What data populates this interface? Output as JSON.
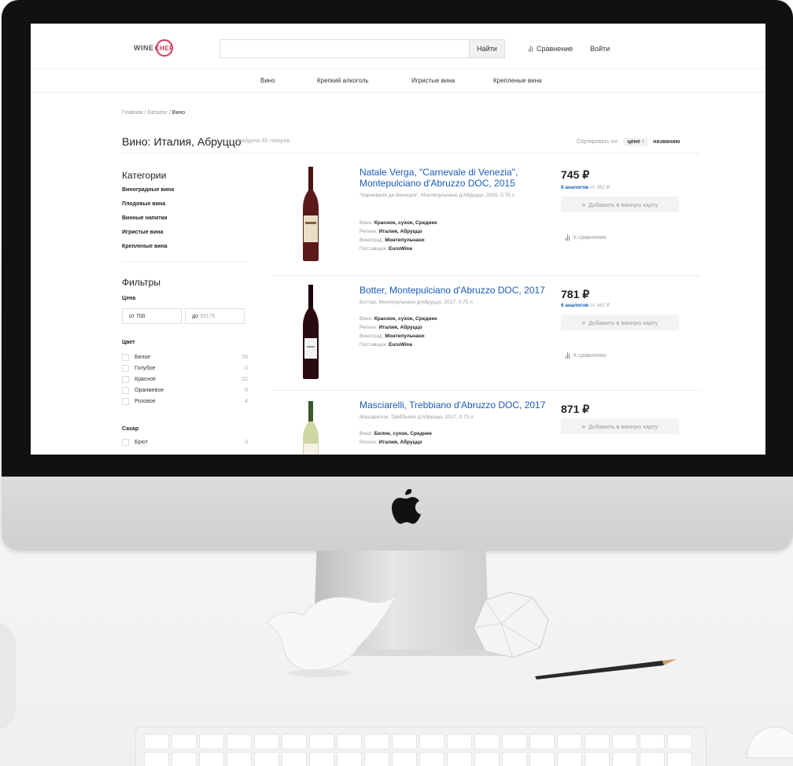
{
  "header": {
    "logo_left": "WINE",
    "logo_right": "CHEF",
    "search_value": "",
    "search_button": "Найти",
    "compare_link": "Сравнение",
    "login_link": "Войти"
  },
  "nav": [
    "Вино",
    "Крепкий алкоголь",
    "Игристые вина",
    "Крепленые вина"
  ],
  "breadcrumb": {
    "home": "Главная",
    "sep": " / ",
    "catalog": "Каталог",
    "current": "Вино"
  },
  "page": {
    "title": "Вино: Италия, Абруццо",
    "found": "Найдено 55 товаров",
    "sort_label": "Сортировать по:",
    "sort_price": "цене ↑",
    "sort_name": "названию"
  },
  "sidebar": {
    "categories_title": "Категории",
    "categories": [
      "Виноградные вина",
      "Плодовые вина",
      "Винные напитки",
      "Игристые вина",
      "Крепленые вина"
    ],
    "filters_title": "Фильтры",
    "price_label": "Цена",
    "price_from": "от 700",
    "price_to_prefix": "до",
    "price_to_value": "39176",
    "color_label": "Цвет",
    "colors": [
      {
        "label": "Белое",
        "count": "29"
      },
      {
        "label": "Голубое",
        "count": "0"
      },
      {
        "label": "Красное",
        "count": "22"
      },
      {
        "label": "Оранжевое",
        "count": "0"
      },
      {
        "label": "Розовое",
        "count": "4"
      }
    ],
    "sugar_label": "Сахар",
    "sugar": [
      {
        "label": "Брют",
        "count": "0"
      }
    ]
  },
  "products": [
    {
      "name": "Natale Verga, \"Carnevale di Venezia\", Montepulciano d'Abruzzo DOC, 2015",
      "subtitle": "\"Карневале ди Венеция\", Монтепульчано д'Абруццо, 2015, 0.75 л",
      "specs": [
        {
          "k": "Вино:",
          "v": "Красное, сухое, Среднее"
        },
        {
          "k": "Регион:",
          "v": "Италия, Абруццо"
        },
        {
          "k": "Виноград:",
          "v": "Монтепульчано"
        },
        {
          "k": "Поставщик:",
          "v": "EuroWine"
        }
      ],
      "price": "745 ₽",
      "analogs_link": "8 аналогов",
      "analogs_from": "от 382 ₽",
      "add_button": "Добавить в винную карту",
      "compare": "К сравнению",
      "bottle_color": "#5a1a1a"
    },
    {
      "name": "Botter, Montepulciano d'Abruzzo DOC, 2017",
      "subtitle": "Боттер, Монтепульчано д'Абруццо, 2017, 0.75 л",
      "specs": [
        {
          "k": "Вино:",
          "v": "Красное, сухое, Среднее"
        },
        {
          "k": "Регион:",
          "v": "Италия, Абруццо"
        },
        {
          "k": "Виноград:",
          "v": "Монтепульчано"
        },
        {
          "k": "Поставщик:",
          "v": "EuroWine"
        }
      ],
      "price": "781 ₽",
      "analogs_link": "6 аналогов",
      "analogs_from": "от 480 ₽",
      "add_button": "Добавить в винную карту",
      "compare": "К сравнению",
      "bottle_color": "#2a0a0e"
    },
    {
      "name": "Masciarelli, Trebbiano d'Abruzzo DOC, 2017",
      "subtitle": "Машарелли, Треббьяно д'Абруццо, 2017, 0.75 л",
      "specs": [
        {
          "k": "Вино:",
          "v": "Белое, сухое, Среднее"
        },
        {
          "k": "Регион:",
          "v": "Италия, Абруццо"
        }
      ],
      "price": "871 ₽",
      "add_button": "Добавить в винную карту",
      "bottle_color": "#cfd6a2"
    }
  ],
  "colors": {
    "accent": "#1a5bb8",
    "brand": "#d13a57"
  }
}
